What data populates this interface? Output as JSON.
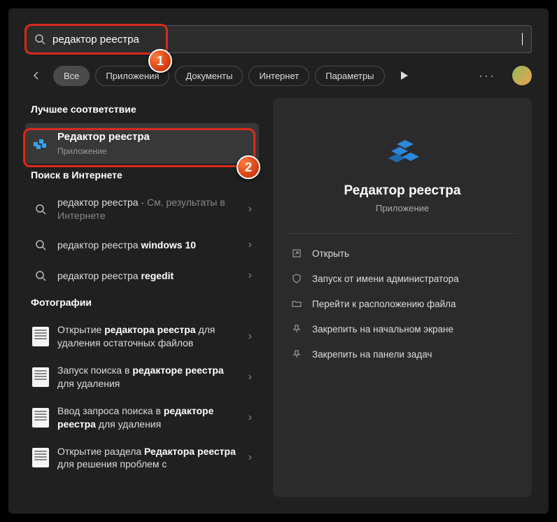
{
  "search": {
    "value": "редактор реестра"
  },
  "tabs": {
    "back_label": "Back",
    "items": [
      {
        "label": "Все",
        "active": true
      },
      {
        "label": "Приложения",
        "active": false
      },
      {
        "label": "Документы",
        "active": false
      },
      {
        "label": "Интернет",
        "active": false
      },
      {
        "label": "Параметры",
        "active": false
      }
    ]
  },
  "sections": {
    "best_match": "Лучшее соответствие",
    "web_search": "Поиск в Интернете",
    "photos": "Фотографии"
  },
  "best_match_item": {
    "title": "Редактор реестра",
    "subtitle": "Приложение"
  },
  "web_results": [
    {
      "pre": "редактор реестра",
      "suffix": " - См. результаты в Интернете"
    },
    {
      "pre": "редактор реестра ",
      "bold": "windows 10"
    },
    {
      "pre": "редактор реестра ",
      "bold": "regedit"
    }
  ],
  "photo_results": [
    "Открытие редактора реестра для удаления остаточных файлов",
    "Запуск поиска в редакторе реестра для удаления",
    "Ввод запроса поиска в редакторе реестра для удаления",
    "Открытие раздела Редактора реестра для решения проблем с"
  ],
  "preview": {
    "title": "Редактор реестра",
    "subtitle": "Приложение",
    "actions": [
      "Открыть",
      "Запуск от имени администратора",
      "Перейти к расположению файла",
      "Закрепить на начальном экране",
      "Закрепить на панели задач"
    ]
  },
  "annotations": {
    "one": "1",
    "two": "2"
  }
}
